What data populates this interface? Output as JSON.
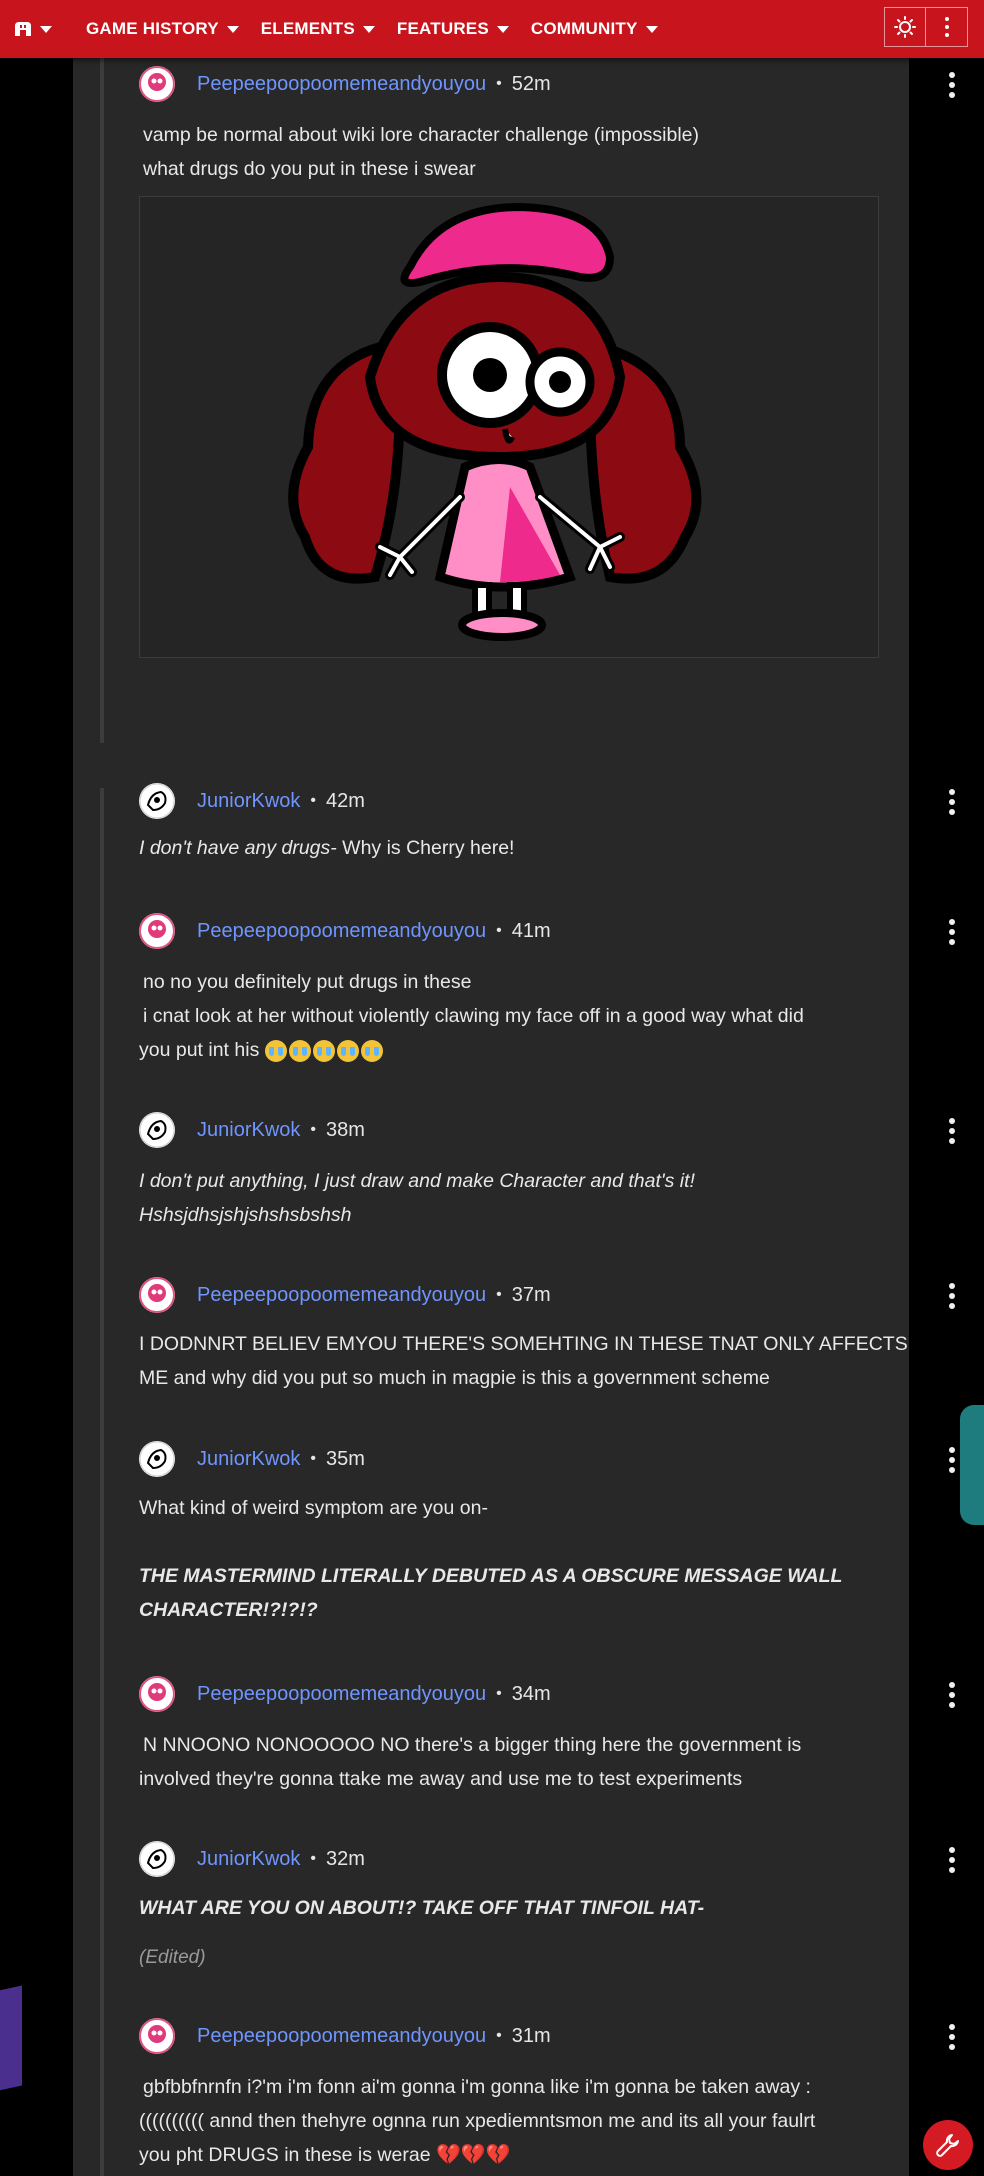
{
  "nav": {
    "items": [
      "GAME HISTORY",
      "ELEMENTS",
      "FEATURES",
      "COMMUNITY"
    ],
    "logo_icon": "fandom-logo-icon",
    "theme_icon": "sun-icon",
    "more_icon": "kebab-icon"
  },
  "comments": [
    {
      "user": "Peepeepoopoomemeandyouyou",
      "time": "52m",
      "lines": [
        "vamp be normal about wiki lore character challenge (impossible)",
        "what drugs do you put in these i swear"
      ],
      "image": "cherry-character-drawing"
    },
    {
      "user": "JuniorKwok",
      "time": "42m",
      "italic_part": "I don't have any drugs-",
      "normal_part": " Why is Cherry here!"
    },
    {
      "user": "Peepeepoopoomemeandyouyou",
      "time": "41m",
      "lines": [
        "no no you definitely put drugs in these",
        "i cnat look at her without violently clawing my face off in a good way what did",
        "you put int his"
      ]
    },
    {
      "user": "JuniorKwok",
      "time": "38m",
      "lines": [
        "I don't put anything, I just draw and make Character and that's it!",
        "Hshsjdhsjshjshshsbshsh"
      ]
    },
    {
      "user": "Peepeepoopoomemeandyouyou",
      "time": "37m",
      "lines": [
        "I DODNNRT BELIEV EMYOU THERE'S SOMEHTING IN THESE TNAT ONLY AFFECTS",
        "ME and why did you put so much in magpie is this a government scheme"
      ]
    },
    {
      "user": "JuniorKwok",
      "time": "35m",
      "lines": [
        "What kind of weird symptom are you on-",
        "THE MASTERMIND LITERALLY DEBUTED AS A OBSCURE MESSAGE WALL",
        "CHARACTER!?!?!?"
      ]
    },
    {
      "user": "Peepeepoopoomemeandyouyou",
      "time": "34m",
      "lines": [
        "N NNOONO NONOOOOO NO there's a bigger thing here the government is",
        "involved they're gonna ttake me away and use me to test experiments"
      ]
    },
    {
      "user": "JuniorKwok",
      "time": "32m",
      "lines": [
        "WHAT ARE YOU ON ABOUT!? TAKE OFF THAT TINFOIL HAT-"
      ],
      "edited": "(Edited)"
    },
    {
      "user": "Peepeepoopoomemeandyouyou",
      "time": "31m",
      "lines": [
        "gbfbbfnrnfn  i?'m i'm fonn ai'm gonna i'm gonna like i'm gonna be taken away :",
        "(((((((((( annd then thehyre ognna run xpediemntsmon me and its all your faulrt",
        "you pht DRUGS in these is werae"
      ]
    }
  ],
  "colors": {
    "nav_bg": "#c8141c",
    "panel_bg": "#282828",
    "username": "#6f95ff"
  },
  "fab_icon": "wrench-icon"
}
